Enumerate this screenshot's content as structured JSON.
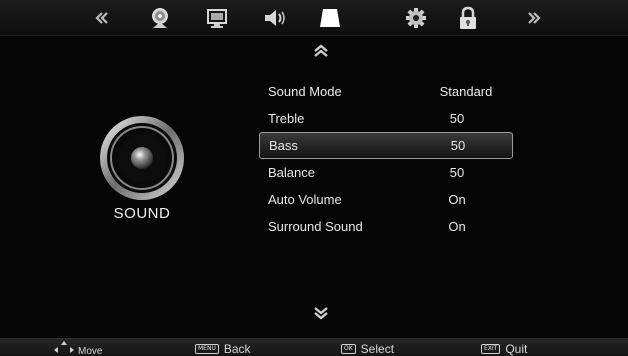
{
  "menu": {
    "tabs": [
      {
        "name": "prev-tab-icon"
      },
      {
        "name": "channel-tab-icon"
      },
      {
        "name": "picture-tab-icon"
      },
      {
        "name": "sound-tab-icon"
      },
      {
        "name": "time-tab-icon",
        "active": true
      },
      {
        "name": "setup-tab-icon"
      },
      {
        "name": "lock-tab-icon"
      },
      {
        "name": "next-tab-icon"
      }
    ]
  },
  "panel": {
    "title": "SOUND",
    "icon": "speaker-icon"
  },
  "settings": [
    {
      "label": "Sound Mode",
      "value": "Standard"
    },
    {
      "label": "Treble",
      "value": "50"
    },
    {
      "label": "Bass",
      "value": "50",
      "selected": true
    },
    {
      "label": "Balance",
      "value": "50"
    },
    {
      "label": "Auto Volume",
      "value": "On"
    },
    {
      "label": "Surround Sound",
      "value": "On"
    }
  ],
  "hints": {
    "move": "Move",
    "back_key": "MENU",
    "back": "Back",
    "select_key": "OK",
    "select": "Select",
    "quit_key": "EXIT",
    "quit": "Quit"
  },
  "colors": {
    "background": "#050505",
    "text": "#e8e8e8",
    "selection_border": "#9a9a9a"
  }
}
